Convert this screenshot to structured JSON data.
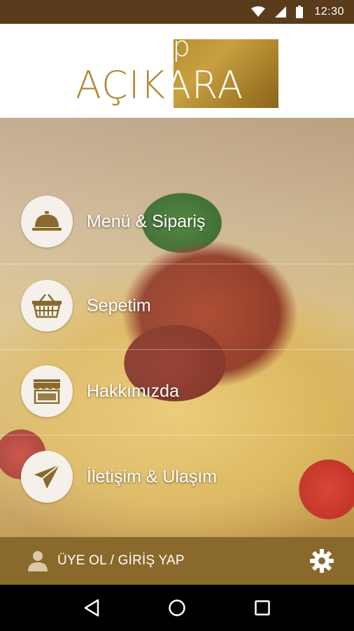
{
  "status_bar": {
    "time": "12:30",
    "icons": [
      "wifi-icon",
      "cell-signal-icon",
      "battery-icon"
    ]
  },
  "header": {
    "logo_small": "ap",
    "logo_part1": "AÇIK",
    "logo_part2": "ARA"
  },
  "menu": {
    "items": [
      {
        "label": "Menü & Sipariş",
        "icon": "cloche-icon"
      },
      {
        "label": "Sepetim",
        "icon": "basket-icon"
      },
      {
        "label": "Hakkımızda",
        "icon": "store-icon"
      },
      {
        "label": "İletişim & Ulaşım",
        "icon": "paper-plane-icon"
      }
    ]
  },
  "footer": {
    "login_label": "ÜYE OL / GİRİŞ YAP",
    "icons": [
      "user-icon",
      "gear-icon"
    ]
  },
  "navbar": {
    "icons": [
      "back-icon",
      "home-icon",
      "recents-icon"
    ]
  },
  "colors": {
    "status_bar": "#5a3c1c",
    "gold": "#b28a36",
    "footer": "#8a6a2c",
    "circle": "#f5f1ea",
    "icon": "#8a6a2c"
  }
}
